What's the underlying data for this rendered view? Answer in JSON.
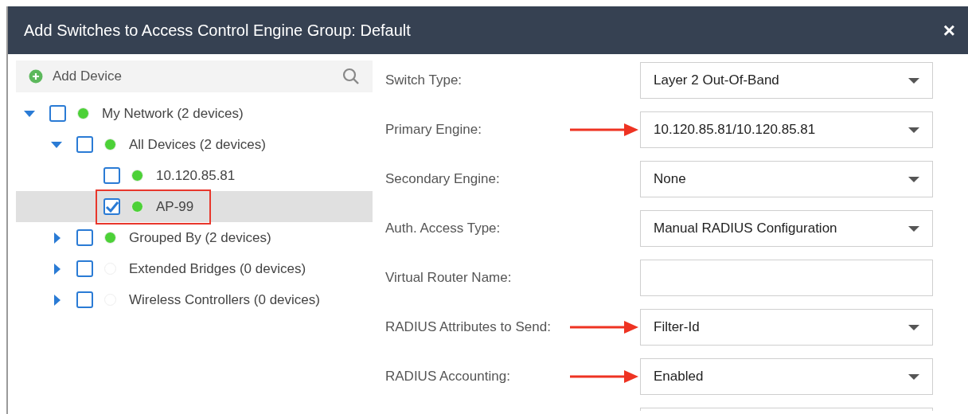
{
  "window": {
    "title": "Add Switches to Access Control Engine Group: Default",
    "close": "×"
  },
  "toolbar": {
    "add_label": "Add Device"
  },
  "tree": [
    {
      "label": "My Network (2 devices)",
      "expanded": true,
      "checked": false,
      "selected": false,
      "highlighted": false,
      "color": "#4cd137",
      "children": [
        {
          "label": "All Devices (2 devices)",
          "expanded": true,
          "checked": false,
          "selected": false,
          "highlighted": false,
          "color": "#4cd137",
          "children": [
            {
              "label": "10.120.85.81",
              "checked": false,
              "selected": false,
              "highlighted": false,
              "color": "#4cd137"
            },
            {
              "label": "AP-99",
              "checked": true,
              "selected": true,
              "highlighted": true,
              "color": "#4cd137"
            }
          ]
        },
        {
          "label": "Grouped By (2 devices)",
          "expanded": false,
          "checked": false,
          "selected": false,
          "highlighted": false,
          "color": "#4cd137"
        },
        {
          "label": "Extended Bridges (0 devices)",
          "expanded": false,
          "checked": false,
          "selected": false,
          "highlighted": false,
          "color": "#ffffff"
        },
        {
          "label": "Wireless Controllers (0 devices)",
          "expanded": false,
          "checked": false,
          "selected": false,
          "highlighted": false,
          "color": "#ffffff"
        }
      ]
    }
  ],
  "form": [
    {
      "kind": "select",
      "label": "Switch Type:",
      "value": "Layer 2 Out-Of-Band",
      "arrow": false
    },
    {
      "kind": "select",
      "label": "Primary Engine:",
      "value": "10.120.85.81/10.120.85.81",
      "arrow": true
    },
    {
      "kind": "select",
      "label": "Secondary Engine:",
      "value": "None",
      "arrow": false
    },
    {
      "kind": "select",
      "label": "Auth. Access Type:",
      "value": "Manual RADIUS Configuration",
      "arrow": false
    },
    {
      "kind": "text",
      "label": "Virtual Router Name:",
      "arrow": false
    },
    {
      "kind": "select",
      "label": "RADIUS Attributes to Send:",
      "value": "Filter-Id",
      "arrow": true
    },
    {
      "kind": "select",
      "label": "RADIUS Accounting:",
      "value": "Enabled",
      "arrow": true
    },
    {
      "kind": "partial",
      "arrow": false
    }
  ]
}
